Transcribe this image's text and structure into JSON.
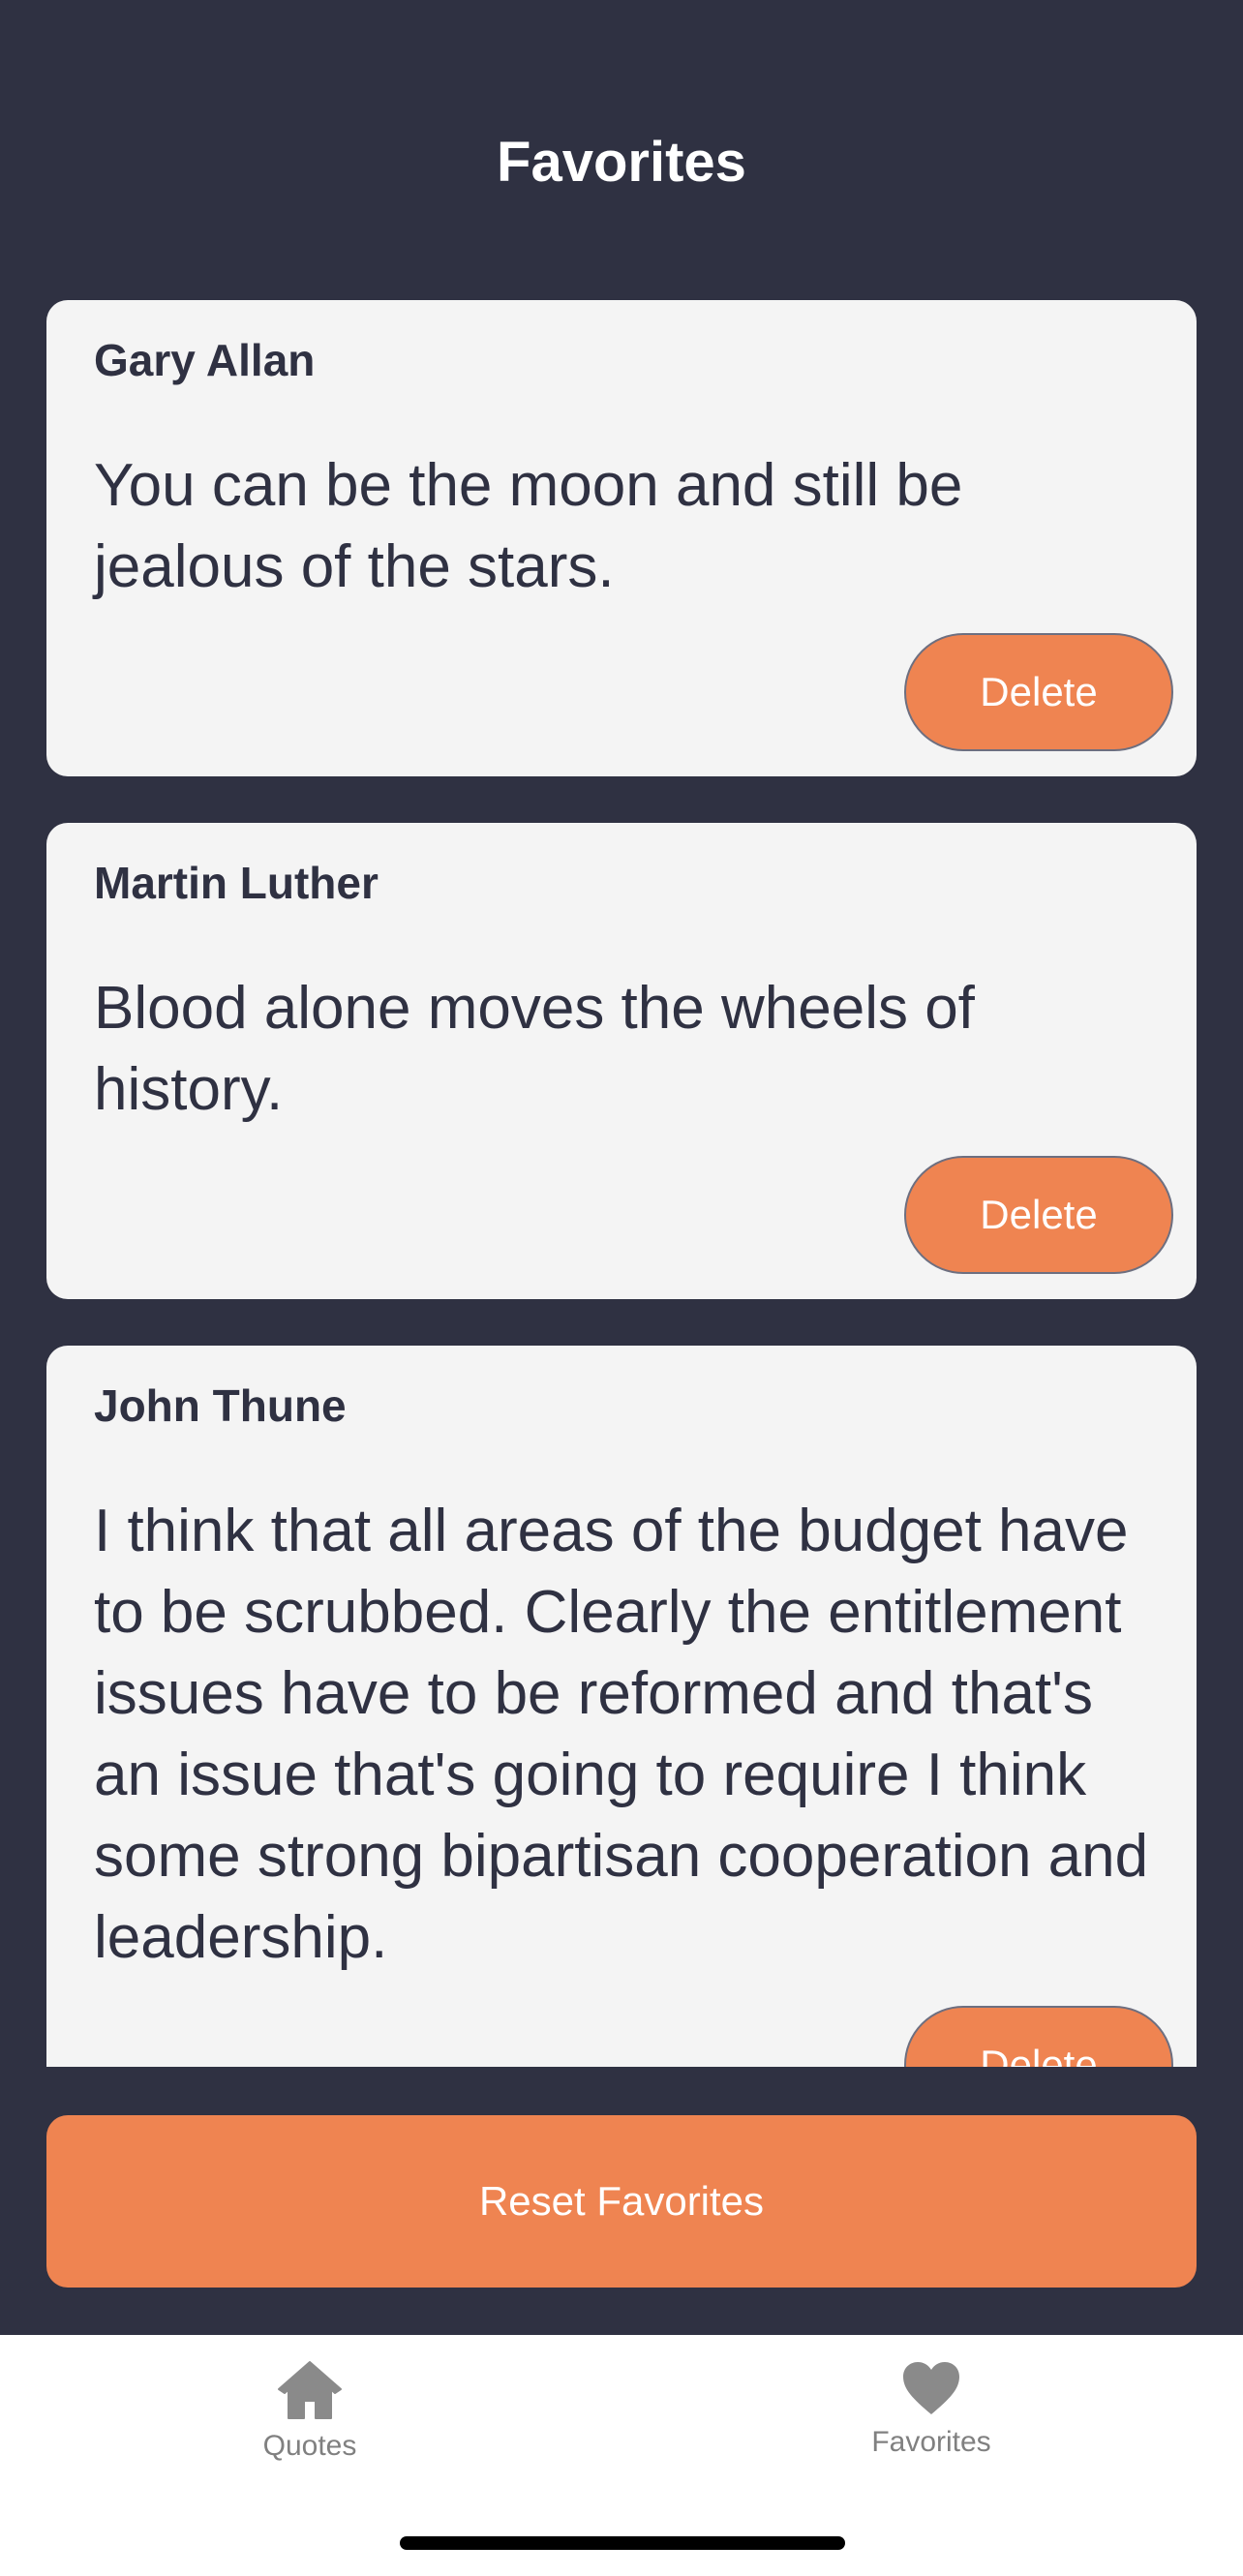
{
  "header": {
    "title": "Favorites"
  },
  "favorites": [
    {
      "author": "Gary Allan",
      "quote": "You can be the moon and still be jealous of the stars.",
      "delete_label": "Delete"
    },
    {
      "author": "Martin Luther",
      "quote": "Blood alone moves the wheels of history.",
      "delete_label": "Delete"
    },
    {
      "author": "John Thune",
      "quote": "I think that all areas of the budget have to be scrubbed. Clearly the entitlement issues have to be reformed and that's an issue that's going to require I think some strong bipartisan cooperation and leadership.",
      "delete_label": "Delete"
    }
  ],
  "reset_button": {
    "label": "Reset Favorites"
  },
  "tabbar": {
    "tabs": [
      {
        "label": "Quotes",
        "icon": "home-icon"
      },
      {
        "label": "Favorites",
        "icon": "heart-icon"
      }
    ]
  },
  "colors": {
    "background": "#2f3142",
    "card": "#f4f4f4",
    "accent": "#ef8451",
    "text_dark": "#2f3142",
    "tab_inactive": "#808080"
  }
}
